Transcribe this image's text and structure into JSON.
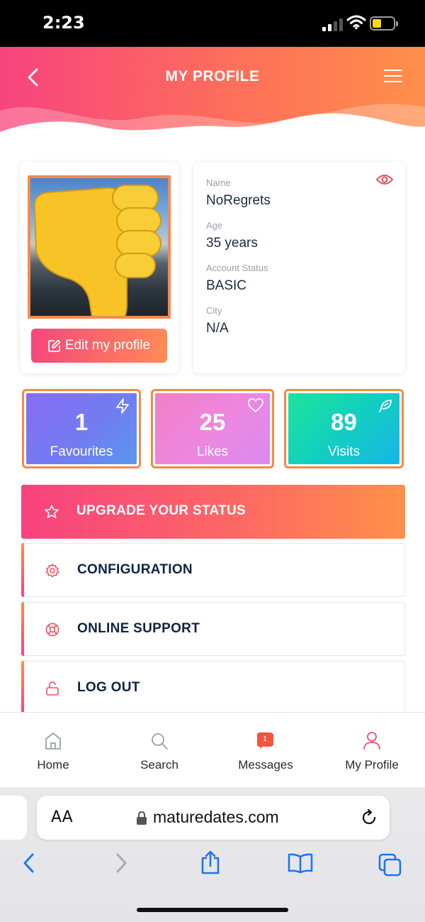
{
  "status_bar": {
    "time": "2:23"
  },
  "header": {
    "title": "MY PROFILE"
  },
  "profile": {
    "edit_button": "Edit my profile",
    "fields": [
      {
        "label": "Name",
        "value": "NoRegrets"
      },
      {
        "label": "Age",
        "value": "35 years"
      },
      {
        "label": "Account Status",
        "value": "BASIC"
      },
      {
        "label": "City",
        "value": "N/A"
      }
    ]
  },
  "stats": [
    {
      "value": "1",
      "label": "Favourites",
      "icon": "lightning-icon"
    },
    {
      "value": "25",
      "label": "Likes",
      "icon": "heart-icon"
    },
    {
      "value": "89",
      "label": "Visits",
      "icon": "feather-icon"
    }
  ],
  "menu": [
    {
      "label": "UPGRADE YOUR STATUS",
      "icon": "star-icon"
    },
    {
      "label": "CONFIGURATION",
      "icon": "gear-icon"
    },
    {
      "label": "ONLINE SUPPORT",
      "icon": "lifebuoy-icon"
    },
    {
      "label": "LOG OUT",
      "icon": "unlock-icon"
    }
  ],
  "tabbar": {
    "items": [
      {
        "label": "Home",
        "icon": "home-icon"
      },
      {
        "label": "Search",
        "icon": "search-icon"
      },
      {
        "label": "Messages",
        "icon": "message-icon",
        "badge": "1"
      },
      {
        "label": "My Profile",
        "icon": "user-icon"
      }
    ]
  },
  "browser": {
    "aa": "AA",
    "url": "maturedates.com"
  },
  "colors": {
    "accent_pink": "#f7437f",
    "accent_orange": "#ff8f4a",
    "favourites": "#7b6cf0",
    "likes": "#ee7ad9",
    "visits": "#12c7d6"
  }
}
